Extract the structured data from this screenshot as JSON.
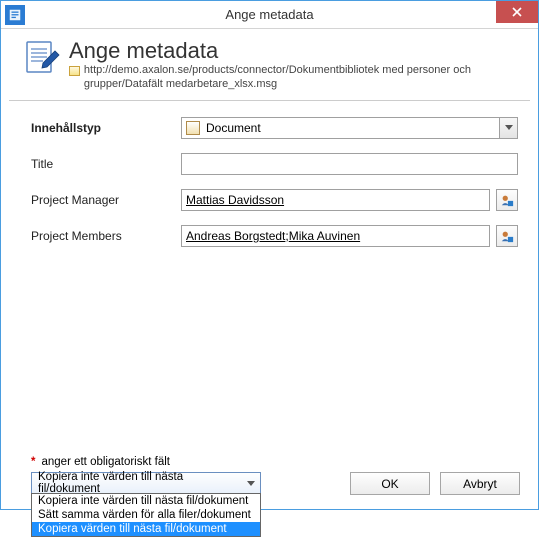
{
  "window_title": "Ange metadata",
  "header": {
    "title": "Ange metadata",
    "url": "http://demo.axalon.se/products/connector/Dokumentbibliotek med personer och grupper/Datafält medarbetare_xlsx.msg"
  },
  "labels": {
    "content_type": "Innehållstyp",
    "title": "Title",
    "project_manager": "Project Manager",
    "project_members": "Project Members"
  },
  "values": {
    "content_type": "Document",
    "title": "",
    "project_manager": "Mattias Davidsson",
    "project_members_1": "Andreas Borgstedt",
    "project_members_sep": "; ",
    "project_members_2": "Mika Auvinen"
  },
  "footer": {
    "required_note": "anger ett obligatoriskt fält",
    "copy_selected": "Kopiera inte värden till nästa fil/dokument",
    "copy_options": {
      "o0": "Kopiera inte värden till nästa fil/dokument",
      "o1": "Sätt samma värden för alla filer/dokument",
      "o2": "Kopiera värden till nästa fil/dokument"
    },
    "ok": "OK",
    "cancel": "Avbryt"
  }
}
